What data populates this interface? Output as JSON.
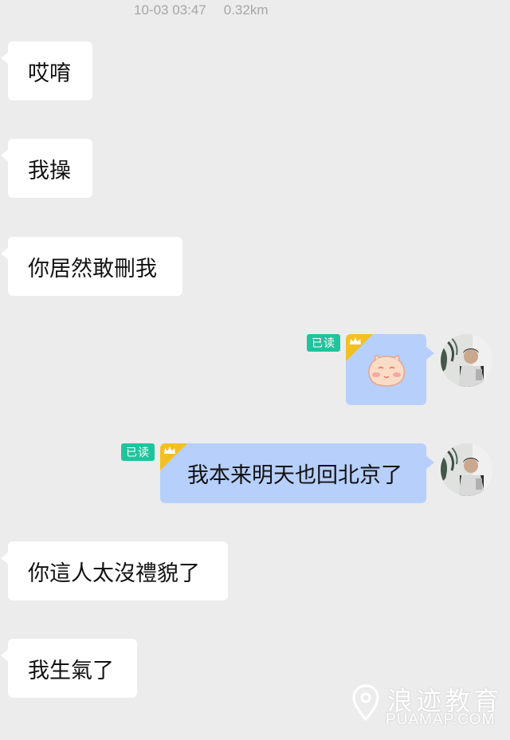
{
  "header": {
    "timestamp": "10-03 03:47",
    "distance": "0.32km"
  },
  "messages": [
    {
      "text": "哎唷"
    },
    {
      "text": "我操"
    },
    {
      "text": "你居然敢刪我"
    },
    {
      "sticker": "blushing-face-sticker",
      "read_badge": "已读"
    },
    {
      "text": "我本来明天也回北京了",
      "read_badge": "已读"
    },
    {
      "text": "你這人太沒禮貌了"
    },
    {
      "text": "我生氣了"
    }
  ],
  "watermark": {
    "brand": "浪迹教育",
    "site": "PUAMAP.COM"
  },
  "colors": {
    "background": "#ececec",
    "incoming_bubble": "#ffffff",
    "outgoing_bubble": "#b7cffb",
    "read_badge": "#1fc49d",
    "crown_accent": "#f3c023"
  }
}
